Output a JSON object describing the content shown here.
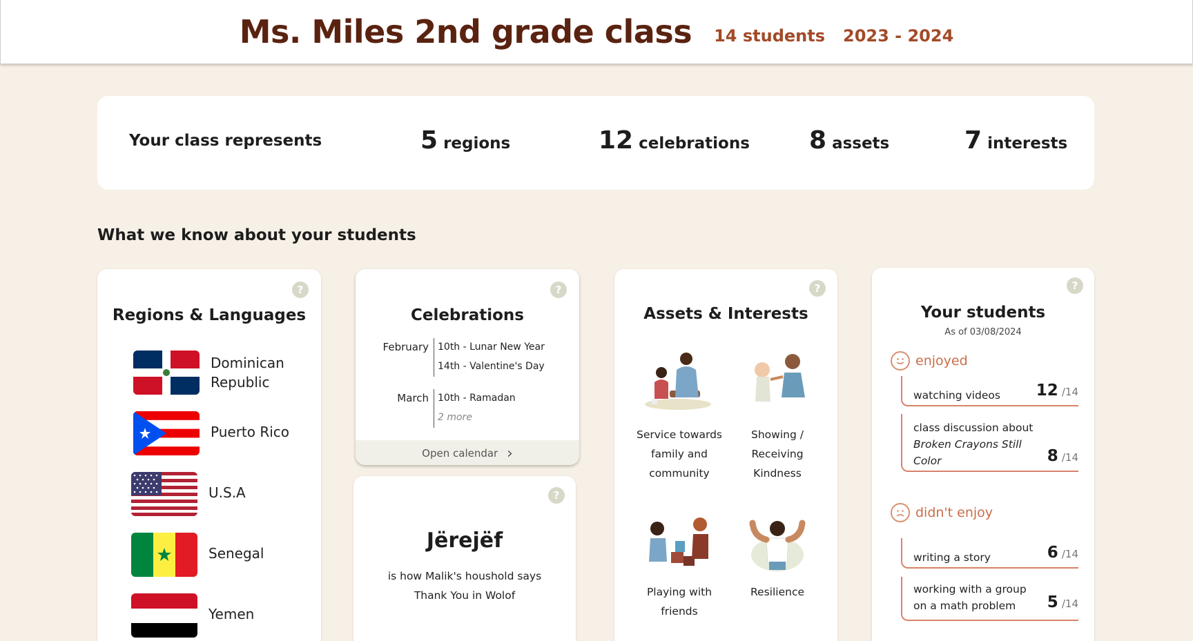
{
  "header": {
    "title": "Ms. Miles 2nd grade class",
    "students": "14 students",
    "year": "2023 - 2024"
  },
  "summary": {
    "lead": "Your class represents",
    "stats": [
      {
        "num": "5",
        "label": "regions"
      },
      {
        "num": "12",
        "label": "celebrations"
      },
      {
        "num": "8",
        "label": "assets"
      },
      {
        "num": "7",
        "label": "interests"
      }
    ]
  },
  "section_title": "What we know about your students",
  "help_glyph": "?",
  "regions": {
    "title": "Regions & Languages",
    "items": [
      {
        "name": "Dominican Republic",
        "flag": "dominican-republic-flag"
      },
      {
        "name": "Puerto Rico",
        "flag": "puerto-rico-flag"
      },
      {
        "name": "U.S.A",
        "flag": "usa-flag"
      },
      {
        "name": "Senegal",
        "flag": "senegal-flag"
      },
      {
        "name": "Yemen",
        "flag": "yemen-flag"
      }
    ]
  },
  "celebrations": {
    "title": "Celebrations",
    "months": [
      {
        "month": "February",
        "events": [
          "10th - Lunar New Year",
          "14th - Valentine's Day"
        ]
      },
      {
        "month": "March",
        "events": [
          "10th - Ramadan"
        ],
        "more": "2 more"
      }
    ],
    "open_calendar": "Open calendar",
    "chevron": "›"
  },
  "wolof": {
    "word": "Jërejëf",
    "line1": "is how Malik's houshold says",
    "line2": "Thank You in Wolof"
  },
  "assets": {
    "title": "Assets & Interests",
    "items": [
      {
        "label_lines": [
          "Service towards",
          "family and",
          "community"
        ],
        "icon": "service-illustration"
      },
      {
        "label_lines": [
          "Showing /",
          "Receiving",
          "Kindness"
        ],
        "icon": "kindness-illustration"
      },
      {
        "label_lines": [
          "Playing with",
          "friends"
        ],
        "icon": "playing-illustration"
      },
      {
        "label_lines": [
          "Resilience"
        ],
        "icon": "resilience-illustration"
      }
    ]
  },
  "your_students": {
    "title": "Your students",
    "as_of": "As of 03/08/2024",
    "enjoyed_label": "enjoyed",
    "didnt_enjoy_label": "didn't enjoy",
    "enjoyed": [
      {
        "text": "watching videos",
        "count": "12",
        "total": "/14"
      },
      {
        "text_pre": "class discussion about",
        "text_italic": "Broken Crayons Still Color",
        "count": "8",
        "total": "/14"
      }
    ],
    "didnt_enjoy": [
      {
        "text": "writing a story",
        "count": "6",
        "total": "/14"
      },
      {
        "text_lines": [
          "working with a group",
          "on a math problem"
        ],
        "count": "5",
        "total": "/14"
      }
    ]
  },
  "colors": {
    "brand_dark": "#5a2210",
    "brand_accent": "#a24a27",
    "mood_accent": "#c96d48",
    "background": "#f7f0e6"
  }
}
